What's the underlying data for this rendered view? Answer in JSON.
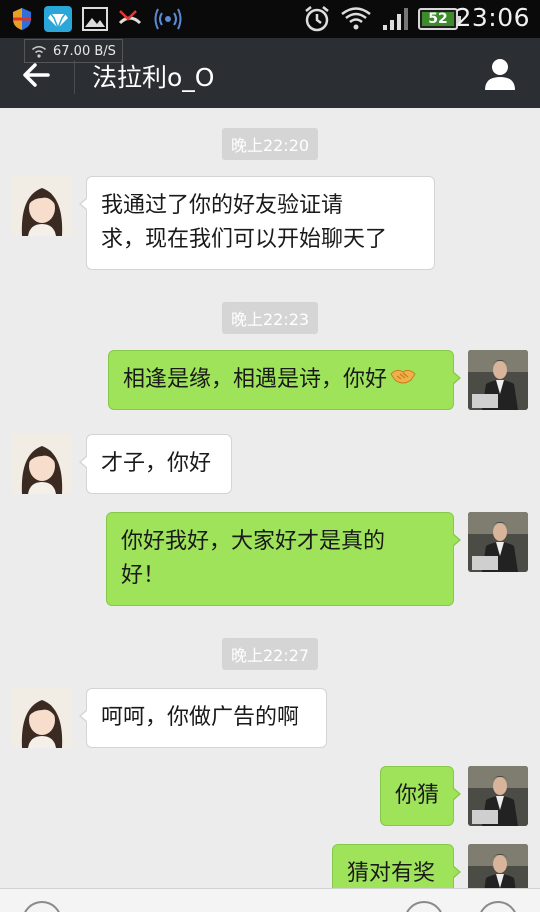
{
  "status_bar": {
    "time": "23:06",
    "battery": "52",
    "net_speed": "67.00 B/S",
    "icons": [
      "shield-icon",
      "diamond-app-icon",
      "gallery-icon",
      "missed-call-icon",
      "wifi-hotspot-icon",
      "alarm-icon",
      "wifi-icon",
      "signal-icon",
      "battery-icon"
    ]
  },
  "header": {
    "title": "法拉利o_O",
    "back_icon": "back-arrow-icon",
    "profile_icon": "person-icon",
    "bg_color": "#2b2f33"
  },
  "messages": [
    {
      "type": "time",
      "text": "晚上22:20"
    },
    {
      "type": "msg",
      "side": "left",
      "avatar": "female-avatar",
      "lines": [
        "我通过了你的好友验证请",
        "求，现在我们可以开始聊天了"
      ]
    },
    {
      "type": "time",
      "text": "晚上22:23"
    },
    {
      "type": "msg",
      "side": "right",
      "avatar": "male-avatar",
      "lines": [
        "相逢是缘，相遇是诗，你好"
      ],
      "emoji": "handshake-emoji"
    },
    {
      "type": "msg",
      "side": "left",
      "avatar": "female-avatar",
      "lines": [
        "才子，你好"
      ]
    },
    {
      "type": "msg",
      "side": "right",
      "avatar": "male-avatar",
      "lines": [
        "你好我好，大家好才是真的",
        "好！"
      ]
    },
    {
      "type": "time",
      "text": "晚上22:27"
    },
    {
      "type": "msg",
      "side": "left",
      "avatar": "female-avatar",
      "lines": [
        "呵呵，你做广告的啊"
      ]
    },
    {
      "type": "msg",
      "side": "right",
      "avatar": "male-avatar",
      "lines": [
        "你猜"
      ]
    },
    {
      "type": "msg",
      "side": "right",
      "avatar": "male-avatar",
      "lines": [
        "猜对有奖"
      ]
    }
  ],
  "colors": {
    "chat_bg": "#ececec",
    "sent_bubble": "#9fe35a",
    "received_bubble": "#ffffff",
    "timestamp_bg": "#d5d5d5"
  }
}
